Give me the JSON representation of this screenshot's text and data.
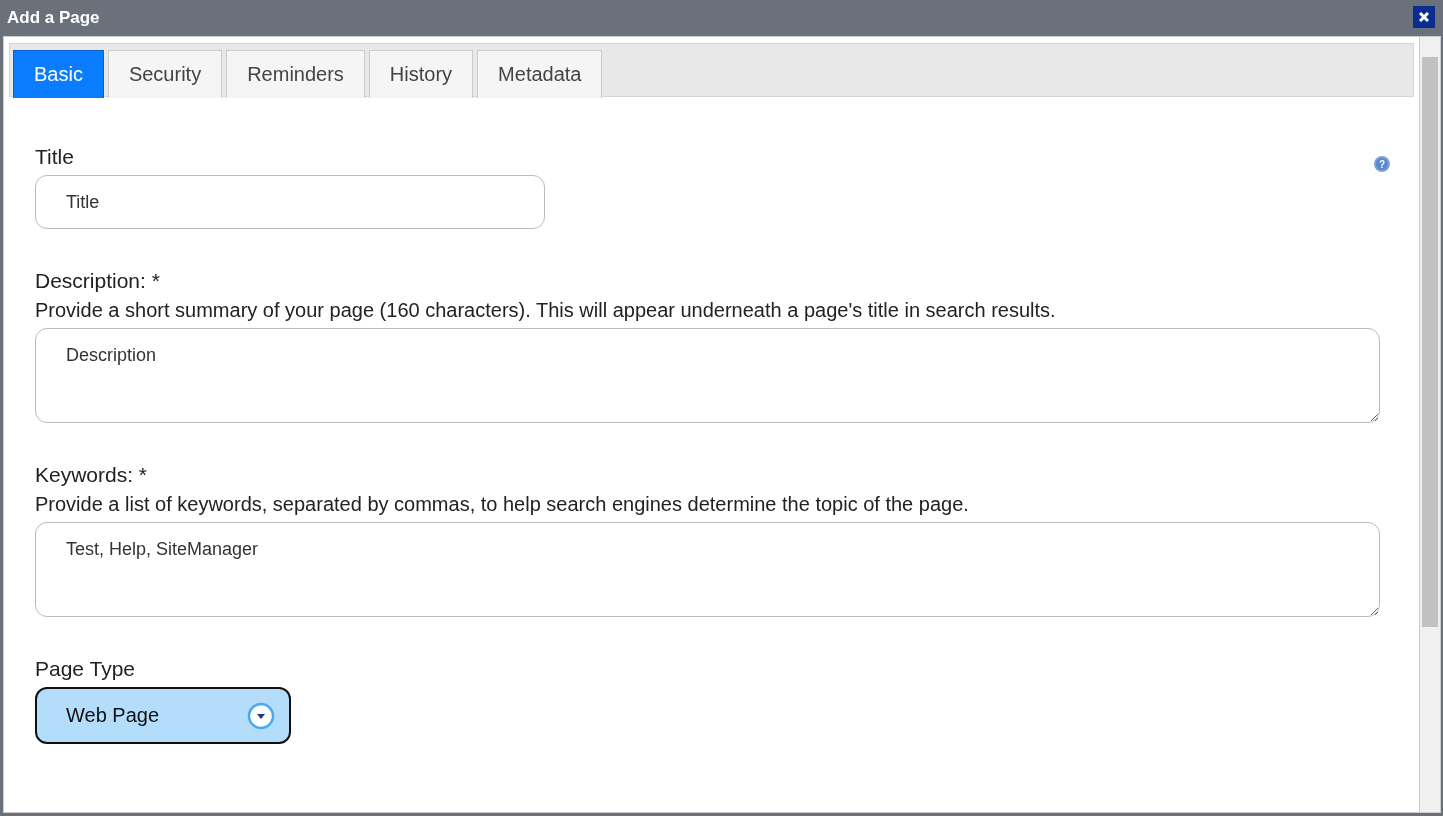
{
  "window": {
    "title": "Add a Page"
  },
  "help_icon": "?",
  "tabs": [
    {
      "label": "Basic",
      "selected": true
    },
    {
      "label": "Security",
      "selected": false
    },
    {
      "label": "Reminders",
      "selected": false
    },
    {
      "label": "History",
      "selected": false
    },
    {
      "label": "Metadata",
      "selected": false
    }
  ],
  "fields": [
    {
      "kind": "input",
      "label": "Title",
      "value": "Title"
    },
    {
      "kind": "textarea",
      "label": "Description: *",
      "hint": "Provide a short summary of your page (160 characters). This will appear underneath a page's title in search results.",
      "value": "Description"
    },
    {
      "kind": "textarea",
      "label": "Keywords: *",
      "hint": "Provide a list of keywords, separated by commas, to help search engines determine the topic of the page.",
      "value": "Test, Help, SiteManager"
    },
    {
      "kind": "select",
      "label": "Page Type",
      "value": "Web Page"
    }
  ]
}
